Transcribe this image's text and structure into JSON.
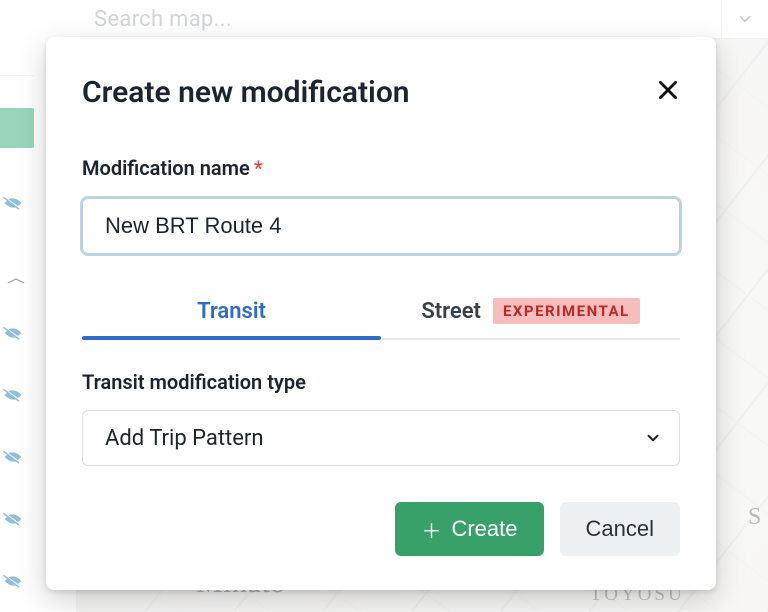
{
  "search": {
    "placeholder": "Search map..."
  },
  "map_labels": {
    "minato": "Minato",
    "toyosu": "TOYOSU",
    "s": "S"
  },
  "modal": {
    "title": "Create new modification",
    "name_label": "Modification name",
    "name_value": "New BRT Route 4",
    "tabs": {
      "transit": "Transit",
      "street": "Street",
      "street_badge": "EXPERIMENTAL"
    },
    "type_label": "Transit modification type",
    "type_value": "Add Trip Pattern",
    "create_label": "Create",
    "cancel_label": "Cancel"
  },
  "colors": {
    "accent_green": "#38a169",
    "accent_blue": "#2f6bcb",
    "badge_bg": "#f7bdbc",
    "badge_fg": "#b82a28"
  }
}
